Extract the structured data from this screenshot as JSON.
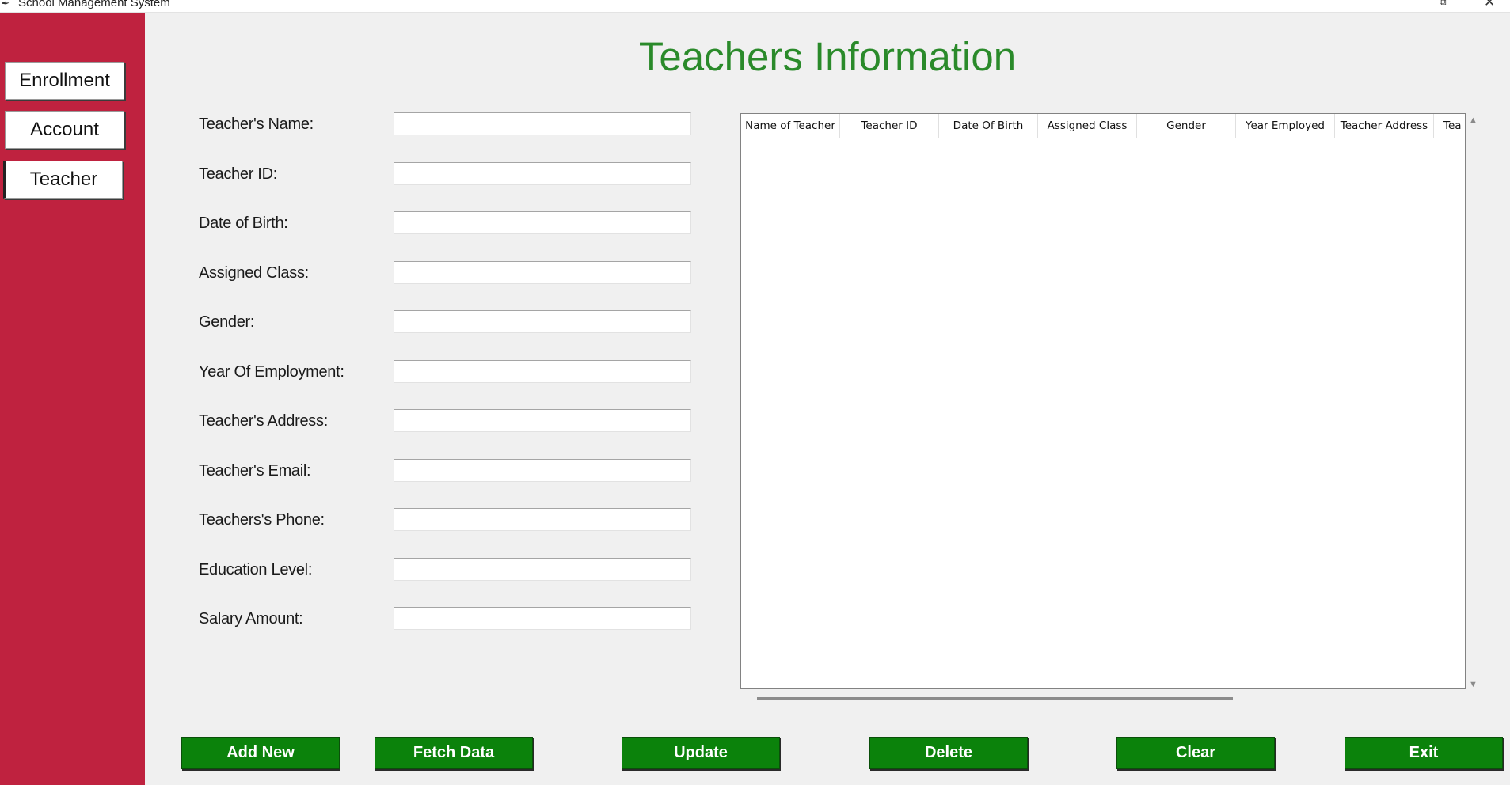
{
  "window": {
    "title": "School Management System",
    "icon": "feather-icon",
    "controls": [
      "restore-icon",
      "close-icon"
    ]
  },
  "sidebar": {
    "items": [
      {
        "label": "Enrollment"
      },
      {
        "label": "Account"
      },
      {
        "label": "Teacher",
        "active": true
      }
    ]
  },
  "page": {
    "title": "Teachers Information"
  },
  "form": {
    "fields": [
      {
        "label": "Teacher's Name:",
        "value": ""
      },
      {
        "label": "Teacher ID:",
        "value": ""
      },
      {
        "label": "Date of Birth:",
        "value": ""
      },
      {
        "label": "Assigned Class:",
        "value": ""
      },
      {
        "label": "Gender:",
        "value": ""
      },
      {
        "label": "Year Of Employment:",
        "value": ""
      },
      {
        "label": "Teacher's Address:",
        "value": ""
      },
      {
        "label": "Teacher's Email:",
        "value": ""
      },
      {
        "label": "Teachers's Phone:",
        "value": ""
      },
      {
        "label": "Education Level:",
        "value": ""
      },
      {
        "label": "Salary Amount:",
        "value": ""
      }
    ]
  },
  "table": {
    "columns": [
      "Name of Teacher",
      "Teacher ID",
      "Date Of Birth",
      "Assigned Class",
      "Gender",
      "Year Employed",
      "Teacher Address",
      "Tea"
    ],
    "rows": []
  },
  "actions": {
    "add_new": "Add New",
    "fetch_data": "Fetch Data",
    "update": "Update",
    "delete": "Delete",
    "clear": "Clear",
    "exit": "Exit"
  },
  "colors": {
    "sidebar_bg": "#bf223f",
    "title_green": "#2a8a2a",
    "button_green": "#0b820b",
    "window_bg": "#f0f0f0"
  }
}
